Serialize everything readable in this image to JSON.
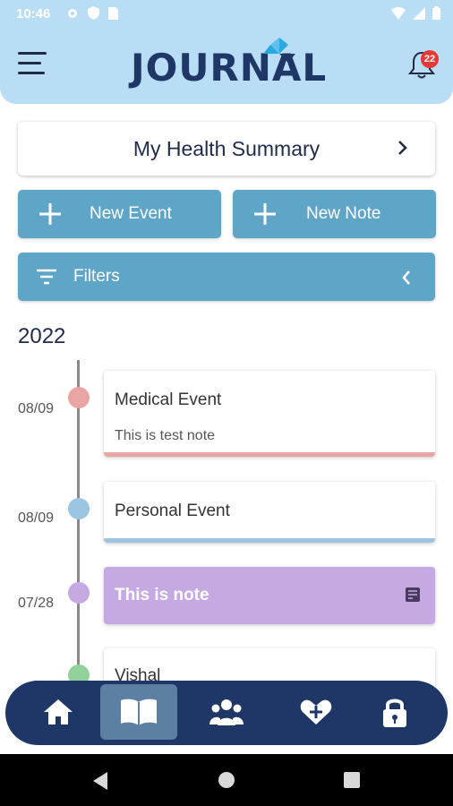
{
  "status_bar": {
    "time": "10:46",
    "icons": [
      "settings-icon",
      "shield-icon",
      "sim-card-icon",
      "wifi-icon",
      "cell-signal-icon",
      "battery-icon"
    ]
  },
  "header": {
    "logo_text": "JOURNAL",
    "notification_count": "22"
  },
  "summary": {
    "label": "My Health Summary"
  },
  "actions": {
    "new_event": "New Event",
    "new_note": "New Note",
    "filters": "Filters"
  },
  "timeline": {
    "year": "2022",
    "entries": [
      {
        "date": "08/09",
        "title": "Medical Event",
        "note": "This is test note",
        "color": "#e8a5a2"
      },
      {
        "date": "08/09",
        "title": "Personal Event",
        "note": "",
        "color": "#9cc6df"
      },
      {
        "date": "07/28",
        "title": "This is note",
        "note": "",
        "color": "#c5a9e3"
      },
      {
        "date": "",
        "title": "Vishal",
        "note": "",
        "color": "#93d19b"
      }
    ]
  },
  "bottom_nav": {
    "items": [
      "home-icon",
      "journal-book-icon",
      "people-icon",
      "health-heart-icon",
      "lock-icon"
    ],
    "active": "journal-book-icon"
  },
  "colors": {
    "header_bg": "#b9ddf4",
    "button_bg": "#5fa5c8",
    "nav_bg": "#1e3766",
    "brand_navy": "#1e3766"
  }
}
